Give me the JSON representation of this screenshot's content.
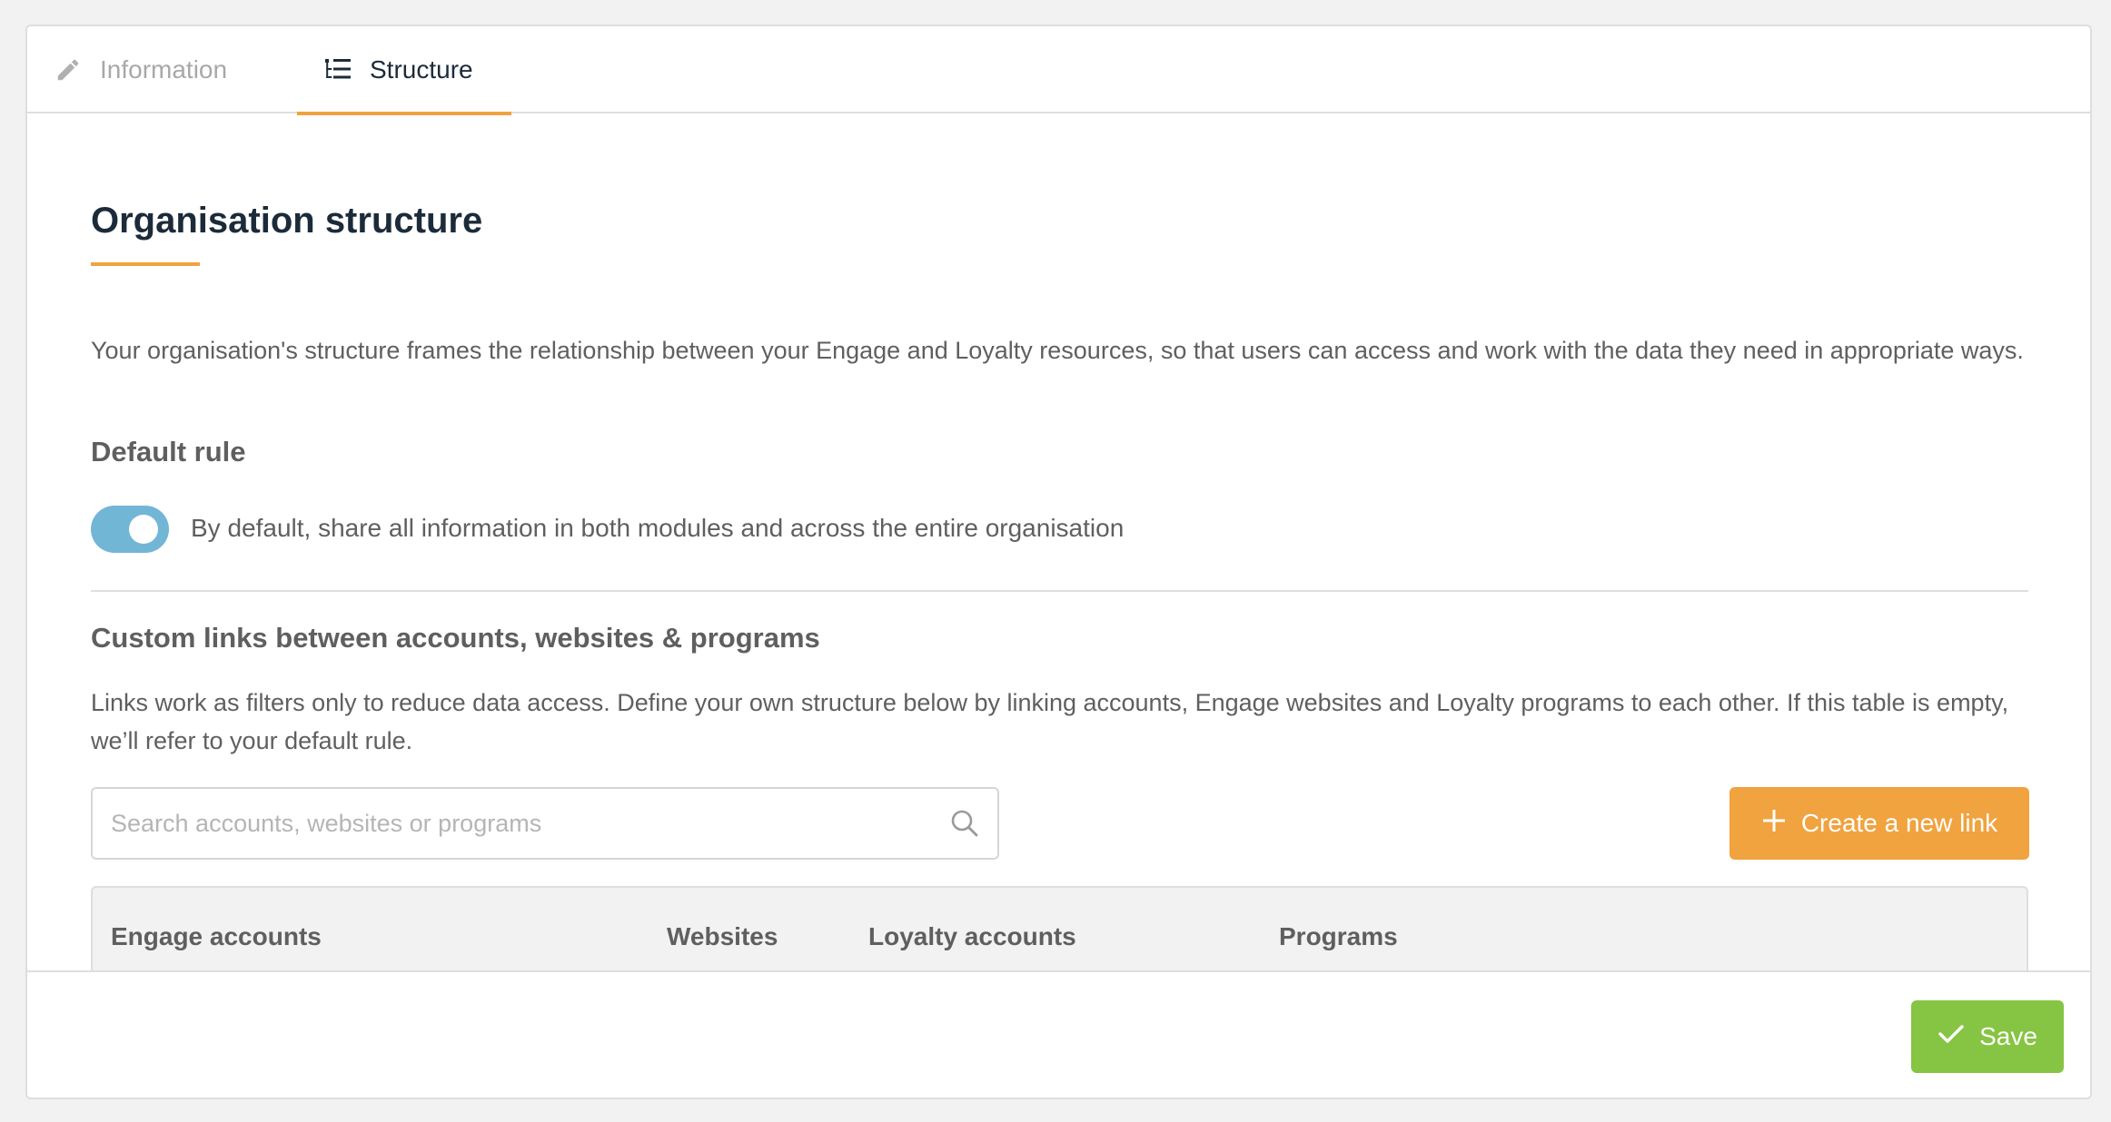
{
  "tabs": [
    {
      "label": "Information",
      "icon": "pencil-icon",
      "active": false
    },
    {
      "label": "Structure",
      "icon": "list-tree-icon",
      "active": true
    }
  ],
  "main": {
    "title": "Organisation structure",
    "intro": "Your organisation's structure frames the relationship between your Engage and Loyalty resources, so that users can access and work with the data they need in appropriate ways.",
    "default_rule": {
      "heading": "Default rule",
      "toggle_on": true,
      "toggle_label": "By default, share all information in both modules and across the entire organisation"
    },
    "custom_links": {
      "heading": "Custom links between accounts, websites & programs",
      "description": "Links work as filters only to reduce data access. Define your own structure below by linking accounts, Engage websites and Loyalty programs to each other. If this table is empty, we’ll refer to your default rule.",
      "search_placeholder": "Search accounts, websites or programs",
      "search_value": "",
      "create_button": "Create a new link",
      "table_columns": [
        "Engage accounts",
        "Websites",
        "Loyalty accounts",
        "Programs"
      ]
    }
  },
  "footer": {
    "save_label": "Save"
  },
  "colors": {
    "accent": "#f0a33f",
    "toggle": "#72b6d6",
    "save": "#86c443",
    "title": "#1c2b3a"
  }
}
